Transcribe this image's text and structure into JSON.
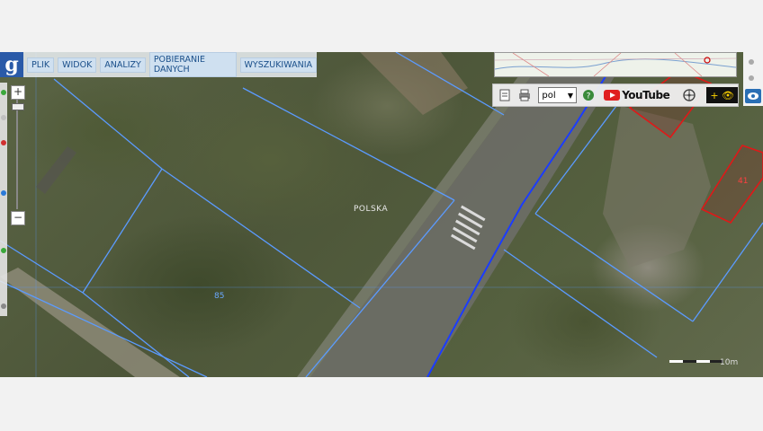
{
  "menu": {
    "logo": "g",
    "items": [
      "PLIK",
      "WIDOK",
      "ANALIZY",
      "POBIERANIE DANYCH",
      "WYSZUKIWANIA"
    ]
  },
  "toolbar": {
    "language": "pol",
    "youtube_label": "YouTube",
    "help_icon": "question-icon",
    "eye_label": "+ 👁"
  },
  "zoom": {
    "plus": "+",
    "minus": "−"
  },
  "map": {
    "country_label": "POLSKA",
    "parcel_label_85": "85",
    "building_label": "41",
    "scale_label": "10m"
  },
  "colors": {
    "parcel_lines": "#5b9bff",
    "building_outline": "#e01818",
    "menu_bg": "#cfe0f0",
    "menu_text": "#1a4f8a"
  }
}
